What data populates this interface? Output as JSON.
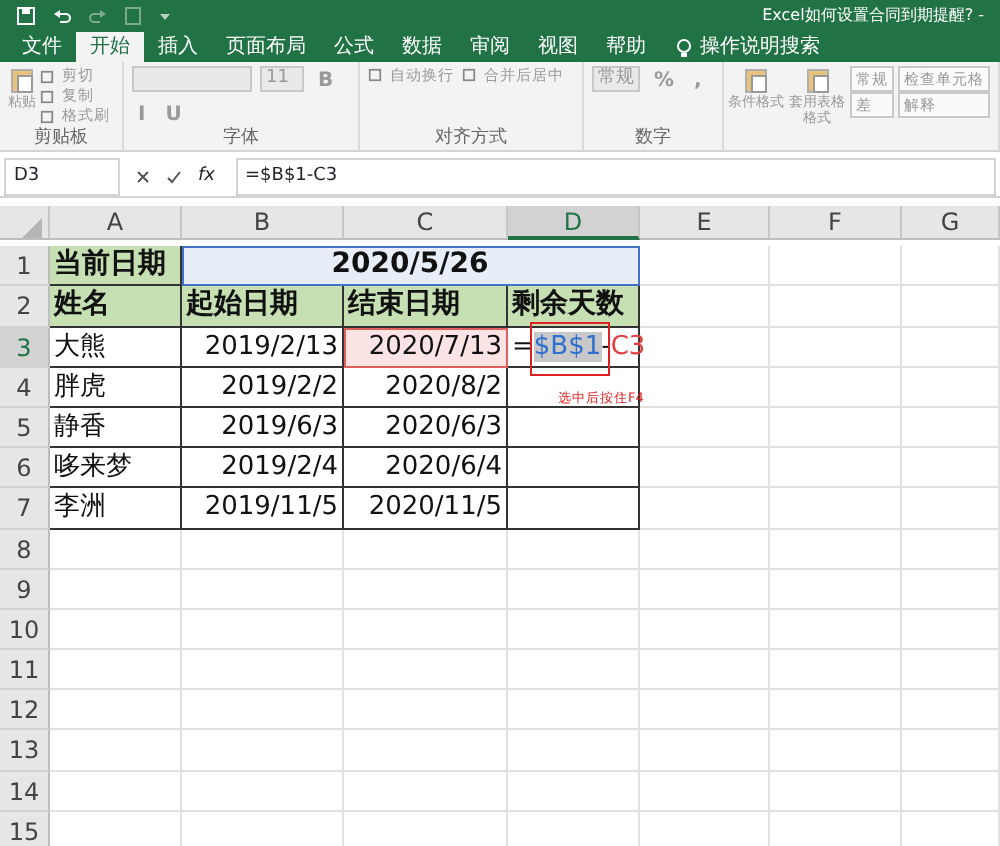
{
  "window": {
    "title": "Excel如何设置合同到期提醒? -"
  },
  "tabs": [
    {
      "label": "文件",
      "selected": false
    },
    {
      "label": "开始",
      "selected": true
    },
    {
      "label": "插入",
      "selected": false
    },
    {
      "label": "页面布局",
      "selected": false
    },
    {
      "label": "公式",
      "selected": false
    },
    {
      "label": "数据",
      "selected": false
    },
    {
      "label": "审阅",
      "selected": false
    },
    {
      "label": "视图",
      "selected": false
    },
    {
      "label": "帮助",
      "selected": false
    }
  ],
  "tell_me": "操作说明搜索",
  "ribbon": [
    {
      "label": "剪贴板",
      "items": [
        {
          "kind": "large",
          "label": "粘贴"
        },
        {
          "kind": "small",
          "label": "剪切"
        },
        {
          "kind": "small",
          "label": "复制"
        },
        {
          "kind": "small",
          "label": "格式刷"
        }
      ]
    },
    {
      "label": "字体",
      "items": [
        {
          "kind": "field"
        },
        {
          "kind": "field",
          "label": "11"
        },
        {
          "kind": "format",
          "label": "B"
        },
        {
          "kind": "format",
          "label": "I"
        },
        {
          "kind": "format",
          "label": "U"
        }
      ]
    },
    {
      "label": "对齐方式",
      "items": [
        {
          "kind": "small",
          "label": "自动换行"
        },
        {
          "kind": "small",
          "label": "合并后居中"
        }
      ]
    },
    {
      "label": "数字",
      "items": [
        {
          "kind": "field",
          "label": "常规"
        },
        {
          "kind": "format",
          "label": "%"
        },
        {
          "kind": "format",
          "label": ","
        }
      ]
    },
    {
      "items": [
        {
          "kind": "large",
          "label": "条件格式"
        },
        {
          "kind": "large",
          "label": "套用表格格式"
        },
        {
          "kind": "style",
          "label": "常规"
        },
        {
          "kind": "style",
          "label": "差"
        },
        {
          "kind": "style",
          "label": "检查单元格"
        },
        {
          "kind": "style",
          "label": "解释"
        }
      ]
    }
  ],
  "name_box": "D3",
  "fx": "fx",
  "formula": "=$B$1-C3",
  "columns": [
    {
      "label": "A",
      "selected": false
    },
    {
      "label": "B",
      "selected": false
    },
    {
      "label": "C",
      "selected": false
    },
    {
      "label": "D",
      "selected": true
    },
    {
      "label": "E",
      "selected": false
    },
    {
      "label": "F",
      "selected": false
    },
    {
      "label": "G",
      "selected": false
    }
  ],
  "rows": [
    {
      "label": "1",
      "selected": false,
      "cells": [
        {
          "kind": "label",
          "text": "当前日期"
        },
        {
          "kind": "merged",
          "text": "2020/5/26"
        }
      ]
    },
    {
      "label": "2",
      "selected": false,
      "cells": [
        {
          "kind": "label",
          "text": "姓名"
        },
        {
          "kind": "label",
          "text": "起始日期"
        },
        {
          "kind": "label",
          "text": "结束日期"
        },
        {
          "kind": "label",
          "text": "剩余天数"
        }
      ]
    },
    {
      "label": "3",
      "selected": true,
      "cells": [
        {
          "kind": "text",
          "text": "大熊"
        },
        {
          "kind": "date",
          "text": "2019/2/13"
        },
        {
          "kind": "ref-target",
          "text": "2020/7/13"
        },
        {
          "kind": "editing",
          "parts": [
            {
              "kind": "plain",
              "text": "="
            },
            {
              "kind": "ref",
              "text": "$B$1",
              "color": "#2f6fd0",
              "selected": true
            },
            {
              "kind": "plain",
              "text": "-"
            },
            {
              "kind": "ref",
              "text": "C3",
              "color": "#e04040",
              "selected": false
            }
          ]
        }
      ]
    },
    {
      "label": "4",
      "selected": false,
      "cells": [
        {
          "kind": "text",
          "text": "胖虎"
        },
        {
          "kind": "date",
          "text": "2019/2/2"
        },
        {
          "kind": "date",
          "text": "2020/8/2"
        }
      ]
    },
    {
      "label": "5",
      "selected": false,
      "cells": [
        {
          "kind": "text",
          "text": "静香"
        },
        {
          "kind": "date",
          "text": "2019/6/3"
        },
        {
          "kind": "date",
          "text": "2020/6/3"
        }
      ]
    },
    {
      "label": "6",
      "selected": false,
      "cells": [
        {
          "kind": "text",
          "text": "哆来梦"
        },
        {
          "kind": "date",
          "text": "2019/2/4"
        },
        {
          "kind": "date",
          "text": "2020/6/4"
        }
      ]
    },
    {
      "label": "7",
      "selected": false,
      "cells": [
        {
          "kind": "text",
          "text": "李洲"
        },
        {
          "kind": "date",
          "text": "2019/11/5"
        },
        {
          "kind": "date",
          "text": "2020/11/5"
        }
      ]
    },
    {
      "label": "8",
      "selected": false
    },
    {
      "label": "9",
      "selected": false
    },
    {
      "label": "10",
      "selected": false
    },
    {
      "label": "11",
      "selected": false
    },
    {
      "label": "12",
      "selected": false
    },
    {
      "label": "13",
      "selected": false
    },
    {
      "label": "14",
      "selected": false
    },
    {
      "label": "15",
      "selected": false
    }
  ],
  "annotation": "选中后按住F4"
}
